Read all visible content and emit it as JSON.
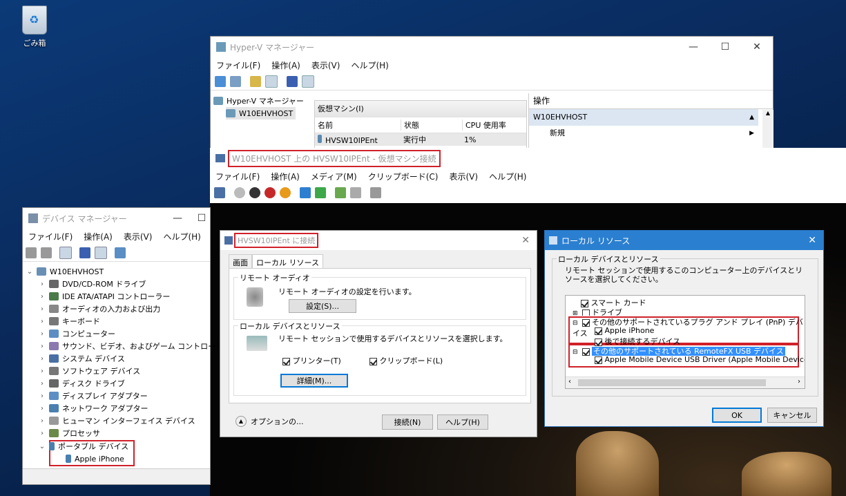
{
  "desktop": {
    "recycle_label": "ごみ箱"
  },
  "hyperv": {
    "title": "Hyper-V マネージャー",
    "menu": [
      "ファイル(F)",
      "操作(A)",
      "表示(V)",
      "ヘルプ(H)"
    ],
    "tree_root": "Hyper-V マネージャー",
    "tree_host": "W10EHVHOST",
    "vm_panel_title": "仮想マシン(I)",
    "columns": [
      "名前",
      "状態",
      "CPU 使用率"
    ],
    "row": {
      "name": "HVSW10IPEnt",
      "state": "実行中",
      "cpu": "1%"
    },
    "actions_title": "操作",
    "actions_host": "W10EHVHOST",
    "actions_new": "新規"
  },
  "vmconnect": {
    "title": "W10EHVHOST 上の HVSW10IPEnt - 仮想マシン接続",
    "menu": [
      "ファイル(F)",
      "操作(A)",
      "メディア(M)",
      "クリップボード(C)",
      "表示(V)",
      "ヘルプ(H)"
    ]
  },
  "devmgr": {
    "title": "デバイス マネージャー",
    "menu": [
      "ファイル(F)",
      "操作(A)",
      "表示(V)",
      "ヘルプ(H)"
    ],
    "root": "W10EHVHOST",
    "items": [
      "DVD/CD-ROM ドライブ",
      "IDE ATA/ATAPI コントローラー",
      "オーディオの入力および出力",
      "キーボード",
      "コンピューター",
      "サウンド、ビデオ、およびゲーム コントローラー",
      "システム デバイス",
      "ソフトウェア デバイス",
      "ディスク ドライブ",
      "ディスプレイ アダプター",
      "ネットワーク アダプター",
      "ヒューマン インターフェイス デバイス",
      "プロセッサ"
    ],
    "portable": "ポータブル デバイス",
    "iphone": "Apple iPhone"
  },
  "connect": {
    "title": "HVSW10IPEnt に接続",
    "tabs": [
      "画面",
      "ローカル リソース"
    ],
    "audio_group": "リモート オーディオ",
    "audio_desc": "リモート オーディオの設定を行います。",
    "audio_btn": "設定(S)...",
    "local_group": "ローカル デバイスとリソース",
    "local_desc": "リモート セッションで使用するデバイスとリソースを選択します。",
    "printer": "プリンター(T)",
    "clipboard": "クリップボード(L)",
    "details_btn": "詳細(M)...",
    "options": "オプションの...",
    "connect_btn": "接続(N)",
    "help_btn": "ヘルプ(H)"
  },
  "local": {
    "title": "ローカル リソース",
    "group": "ローカル デバイスとリソース",
    "desc": "リモート セッションで使用するこのコンピューター上のデバイスとリソースを選択してください。",
    "items": [
      "スマート カード",
      "ドライブ",
      "その他のサポートされているプラグ アンド プレイ (PnP) デバイス",
      "Apple iPhone",
      "後で接続するデバイス",
      "その他のサポートされている RemoteFX USB デバイス",
      "Apple Mobile Device USB Driver (Apple Mobile Device"
    ],
    "ok": "OK",
    "cancel": "キャンセル"
  },
  "colors": {
    "highlight": "#d0202a",
    "accent": "#0078d7",
    "selection": "#3390ff"
  }
}
